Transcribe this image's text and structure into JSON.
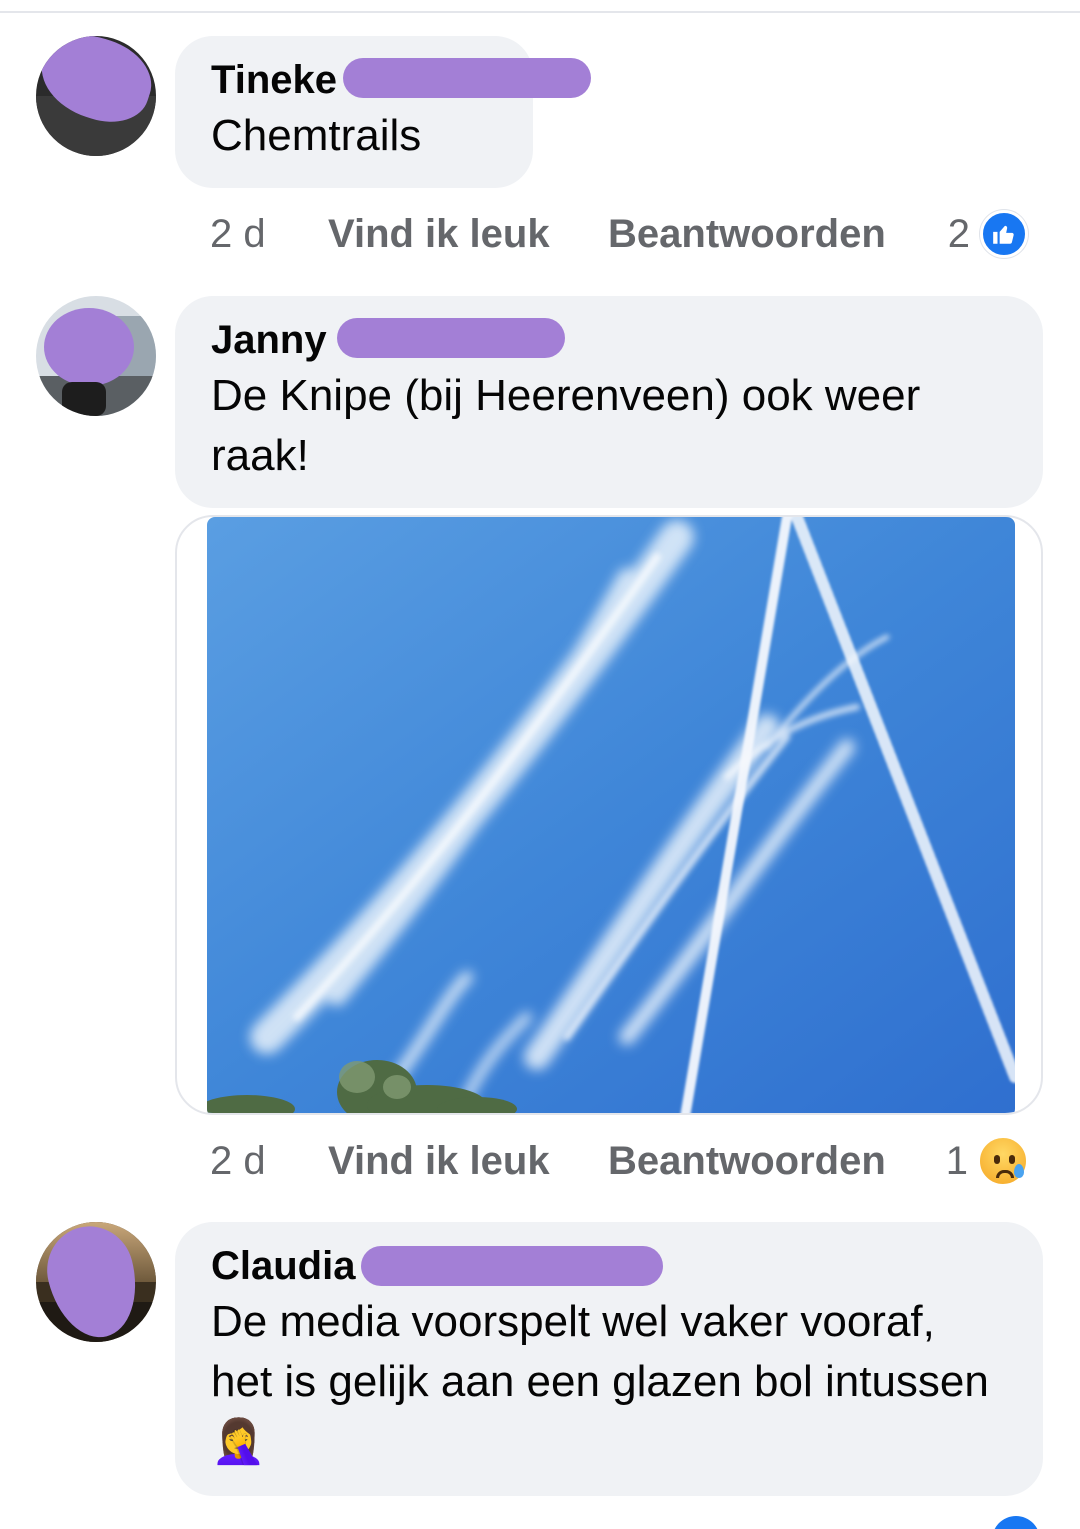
{
  "comments": [
    {
      "author": "Tineke",
      "text": "Chemtrails",
      "time": "2 d",
      "like_label": "Vind ik leuk",
      "reply_label": "Beantwoorden",
      "reaction_count": "2",
      "reaction_icon": "like-reaction-icon"
    },
    {
      "author": "Janny",
      "text": "De Knipe (bij Heerenveen) ook weer raak!",
      "time": "2 d",
      "like_label": "Vind ik leuk",
      "reply_label": "Beantwoorden",
      "reaction_count": "1",
      "reaction_icon": "sad-reaction-icon"
    },
    {
      "author": "Claudia",
      "text": "De media voorspelt wel vaker vooraf, het is gelijk aan een glazen bol intussen",
      "emoji": "🤦‍♀️"
    }
  ],
  "colors": {
    "bubble": "#f0f2f5",
    "meta_text": "#65676b",
    "like_blue": "#1877f2",
    "redaction": "#a37fd6",
    "sky": "#3f86d8"
  }
}
